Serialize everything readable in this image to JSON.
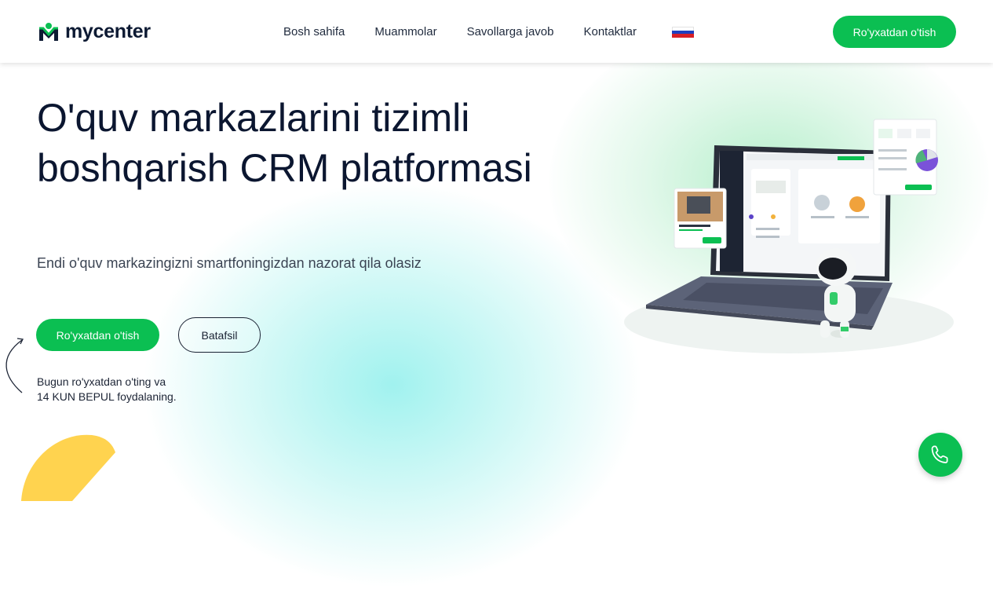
{
  "brand": {
    "name": "mycenter",
    "accent": "#0bbf52"
  },
  "nav": {
    "items": [
      "Bosh sahifa",
      "Muammolar",
      "Savollarga javob",
      "Kontaktlar"
    ],
    "language_flag": "russian-flag-icon"
  },
  "header": {
    "cta_label": "Ro'yxatdan o'tish"
  },
  "hero": {
    "title": "O'quv markazlarini tizimli boshqarish CRM platformasi",
    "subtitle": "Endi o'quv markazingizni smartfoningizdan nazorat qila olasiz",
    "primary_button": "Ro'yxatdan o'tish",
    "secondary_button": "Batafsil",
    "note_line1": "Bugun ro'yxatdan o'ting va",
    "note_line2": "14 KUN BEPUL foydalaning."
  },
  "icons": {
    "logo": "mycenter-logo-icon",
    "call": "phone-icon",
    "arrow": "curved-arrow-icon"
  }
}
